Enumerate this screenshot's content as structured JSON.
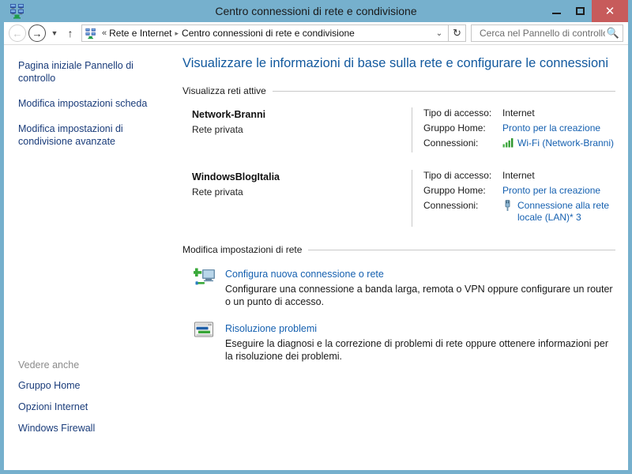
{
  "window": {
    "title": "Centro connessioni di rete e condivisione",
    "icon": "network-sharing-icon",
    "controls": {
      "minimize": "minimize-icon",
      "maximize": "maximize-icon",
      "close": "✕"
    }
  },
  "navbar": {
    "back": "←",
    "forward": "→",
    "history_dropdown": "▼",
    "up": "↑",
    "breadcrumb": {
      "icon": "network-sharing-icon",
      "overflow": "«",
      "items": [
        "Rete e Internet",
        "Centro connessioni di rete e condivisione"
      ],
      "separator": "▸",
      "dropdown": "⌄"
    },
    "refresh": "↻",
    "search": {
      "placeholder": "Cerca nel Pannello di controllo",
      "value": "",
      "icon": "search-icon"
    }
  },
  "sidebar": {
    "links": [
      "Pagina iniziale Pannello di controllo",
      "Modifica impostazioni scheda",
      "Modifica impostazioni di condivisione avanzate"
    ],
    "see_also_heading": "Vedere anche",
    "see_also_links": [
      "Gruppo Home",
      "Opzioni Internet",
      "Windows Firewall"
    ]
  },
  "main": {
    "page_title": "Visualizzare le informazioni di base sulla rete e configurare le connessioni",
    "active_networks_heading": "Visualizza reti attive",
    "networks": [
      {
        "name": "Network-Branni",
        "type": "Rete privata",
        "access_label": "Tipo di accesso:",
        "access_value": "Internet",
        "homegroup_label": "Gruppo Home:",
        "homegroup_value": "Pronto per la creazione",
        "connections_label": "Connessioni:",
        "connections_value": "Wi-Fi (Network-Branni)",
        "connections_icon": "wifi-signal-icon"
      },
      {
        "name": "WindowsBlogItalia",
        "type": "Rete privata",
        "access_label": "Tipo di accesso:",
        "access_value": "Internet",
        "homegroup_label": "Gruppo Home:",
        "homegroup_value": "Pronto per la creazione",
        "connections_label": "Connessioni:",
        "connections_value": "Connessione alla rete locale (LAN)* 3",
        "connections_icon": "lan-plug-icon"
      }
    ],
    "change_settings_heading": "Modifica impostazioni di rete",
    "tasks": [
      {
        "icon": "new-connection-icon",
        "link": "Configura nuova connessione o rete",
        "description": "Configurare una connessione a banda larga, remota o VPN oppure configurare un router o un punto di accesso."
      },
      {
        "icon": "troubleshoot-icon",
        "link": "Risoluzione problemi",
        "description": "Eseguire la diagnosi e la correzione di problemi di rete oppure ottenere informazioni per la risoluzione dei problemi."
      }
    ]
  },
  "colors": {
    "titlebar": "#76b0cd",
    "close_button": "#c75b5b",
    "heading_blue": "#12599e",
    "link_blue": "#1560b0",
    "sidebar_link": "#1a3c7a",
    "signal_green": "#3aa93a"
  }
}
